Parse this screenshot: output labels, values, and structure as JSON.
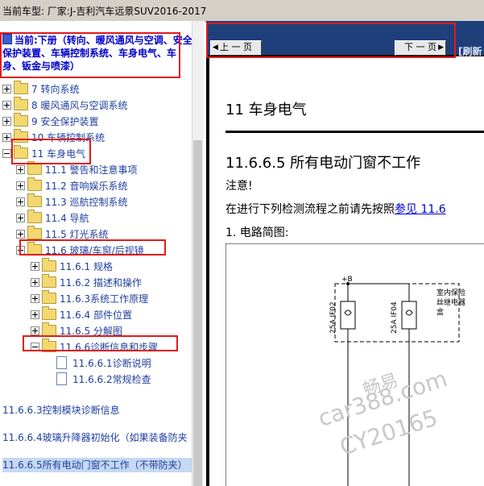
{
  "header": {
    "vehicle_label": "当前车型:   厂家:J-吉利汽车远景SUV2016-2017"
  },
  "sidebar": {
    "book_title": "当前:下册（转向、暖风通风与空调、安全保护装置、车辆控制系统、车身电气、车身、钣金与喷漆）",
    "tree": [
      {
        "label": "7 转向系统",
        "expanded": false
      },
      {
        "label": "8 暖风通风与空调系统",
        "expanded": false
      },
      {
        "label": "9 安全保护装置",
        "expanded": false
      },
      {
        "label": "10 车辆控制系统",
        "expanded": false
      },
      {
        "label": "11 车身电气",
        "expanded": true
      },
      {
        "label": "11.1 警告和注意事项",
        "expanded": false
      },
      {
        "label": "11.2 音响娱乐系统",
        "expanded": false
      },
      {
        "label": "11.3 巡航控制系统",
        "expanded": false
      },
      {
        "label": "11.4 导航",
        "expanded": false
      },
      {
        "label": "11.5 灯光系统",
        "expanded": false
      },
      {
        "label": "11.6 玻璃/车窗/后视镜",
        "expanded": true
      },
      {
        "label": "11.6.1 规格",
        "expanded": false
      },
      {
        "label": "11.6.2 描述和操作",
        "expanded": false
      },
      {
        "label": "11.6.3系统工作原理",
        "expanded": false
      },
      {
        "label": "11.6.4 部件位置",
        "expanded": false
      },
      {
        "label": "11.6.5 分解图",
        "expanded": false
      },
      {
        "label": "11.6.6诊断信息和步骤",
        "expanded": true
      },
      {
        "label": "11.6.6.1诊断说明"
      },
      {
        "label": "11.6.6.2常规检查"
      }
    ],
    "leaves": [
      {
        "label": "11.6.6.3控制模块诊断信息"
      },
      {
        "label": "11.6.6.4玻璃升降器初始化（如果装备防夹"
      },
      {
        "label": "11.6.6.5所有电动门窗不工作（不带防夹）"
      }
    ]
  },
  "toolbar": {
    "prev_label": "上 一 页",
    "next_label": "下 一 页",
    "refresh_label": "[刷新"
  },
  "document": {
    "chapter_title": "11 车身电气",
    "section_title": "11.6.6.5 所有电动门窗不工作",
    "note_label": "注意!",
    "instruction_prefix": "在进行下列检测流程之前请先按照",
    "instruction_link": "参见 11.6",
    "item_label": "1.   电路简图:",
    "diagram": {
      "plus_b": "+B",
      "fuse1_label": "25A  IF02",
      "fuse2_label": "25A  IF04",
      "box_label_line1": "室内保险",
      "box_label_line2": "丝继电器",
      "box_label_line3": "盒"
    }
  },
  "watermark": {
    "line1": "畅易",
    "line2": "car388.com",
    "line3": "CY20165"
  },
  "colors": {
    "highlight": "#e01b1b",
    "tree_text": "#1f3f9f",
    "toolbar_bg": "#1f3f7a",
    "selected_row": "#c6d8f2"
  }
}
